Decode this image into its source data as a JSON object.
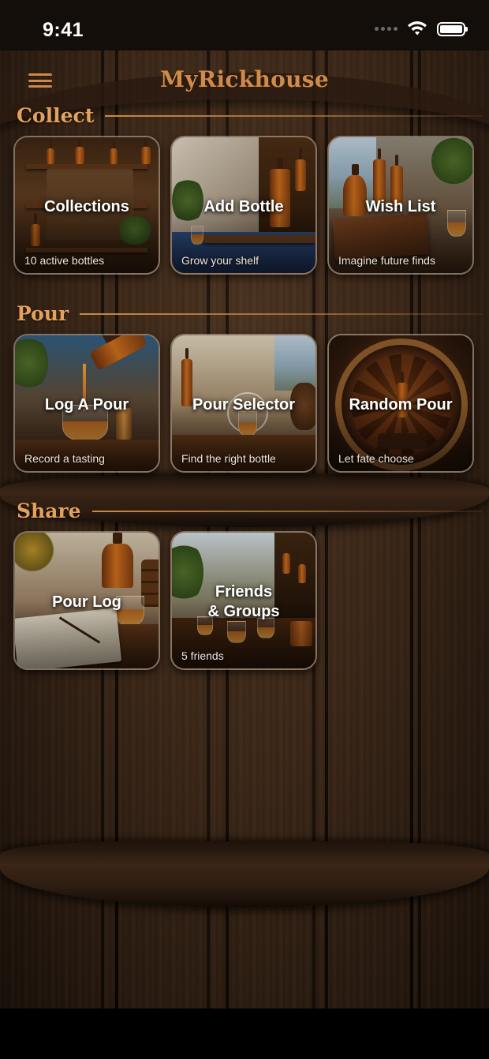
{
  "status_bar": {
    "time": "9:41"
  },
  "header": {
    "title": "MyRickhouse",
    "menu_icon": "hamburger-menu-icon"
  },
  "colors": {
    "accent": "#d08b48",
    "section_title": "#e3a15e",
    "tile_border": "#c8b4a0"
  },
  "sections": [
    {
      "title": "Collect",
      "tiles": [
        {
          "title": "Collections",
          "subtitle": "10 active bottles"
        },
        {
          "title": "Add Bottle",
          "subtitle": "Grow your shelf"
        },
        {
          "title": "Wish List",
          "subtitle": "Imagine future finds"
        }
      ]
    },
    {
      "title": "Pour",
      "tiles": [
        {
          "title": "Log A Pour",
          "subtitle": "Record a tasting"
        },
        {
          "title": "Pour Selector",
          "subtitle": "Find the right bottle"
        },
        {
          "title": "Random Pour",
          "subtitle": "Let fate choose"
        }
      ]
    },
    {
      "title": "Share",
      "tiles": [
        {
          "title": "Pour Log",
          "subtitle": ""
        },
        {
          "title_line1": "Friends",
          "title_line2": "& Groups",
          "subtitle": "5 friends"
        }
      ]
    }
  ]
}
